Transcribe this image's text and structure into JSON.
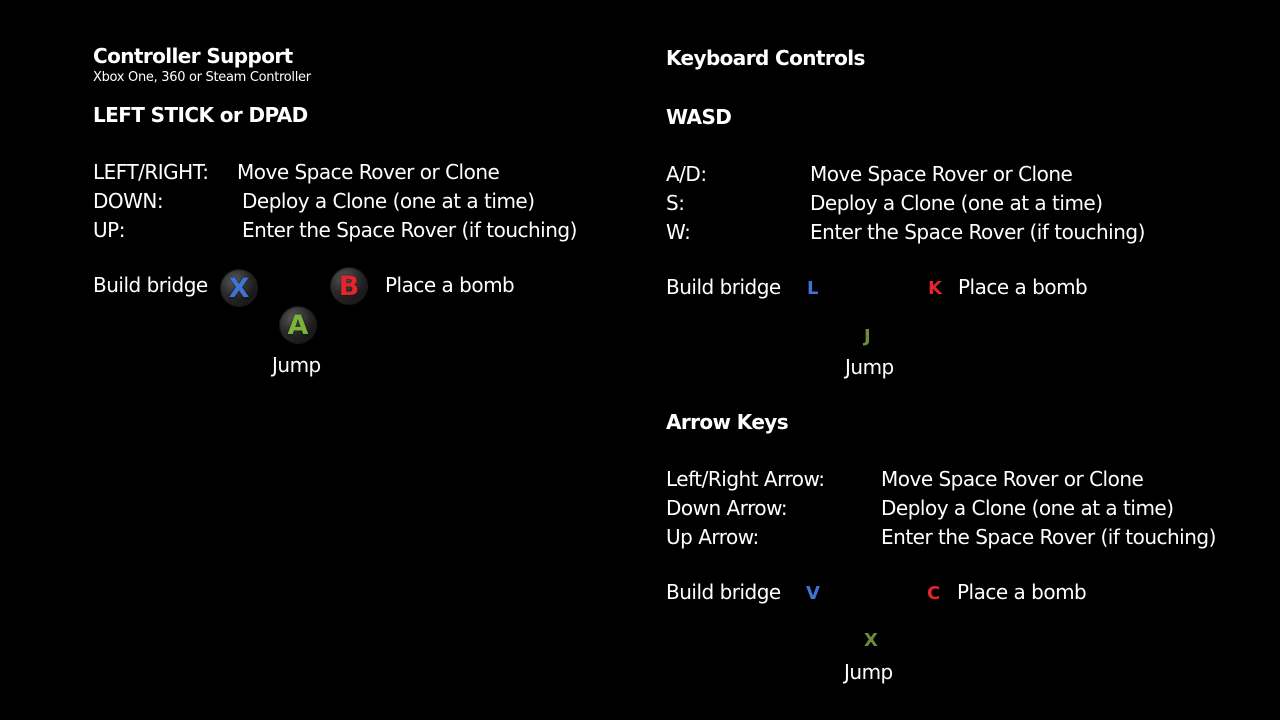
{
  "colors": {
    "background": "#000000",
    "text": "#ffffff",
    "blue": "#3f74d6",
    "red": "#e2262c",
    "green": "#7ab33a",
    "olive": "#6f8a3b"
  },
  "controller": {
    "title": "Controller Support",
    "subtitle": "Xbox One, 360 or Steam Controller",
    "stick_heading": "LEFT STICK or DPAD",
    "bindings": [
      {
        "key": "LEFT/RIGHT:",
        "action": "Move Space Rover or Clone"
      },
      {
        "key": "DOWN:",
        "action": "Deploy a Clone (one at a time)"
      },
      {
        "key": "UP:",
        "action": "Enter the Space Rover (if touching)"
      }
    ],
    "build_label": "Build bridge",
    "bomb_label": "Place a bomb",
    "jump_label": "Jump",
    "buttons": {
      "build": {
        "letter": "X",
        "icon": "xbox-x-button-icon"
      },
      "bomb": {
        "letter": "B",
        "icon": "xbox-b-button-icon"
      },
      "jump": {
        "letter": "A",
        "icon": "xbox-a-button-icon"
      }
    }
  },
  "keyboard": {
    "title": "Keyboard Controls",
    "wasd": {
      "heading": "WASD",
      "bindings": [
        {
          "key": "A/D:",
          "action": "Move Space Rover or Clone"
        },
        {
          "key": "S:",
          "action": "Deploy a Clone (one at a time)"
        },
        {
          "key": "W:",
          "action": "Enter the Space Rover (if touching)"
        }
      ],
      "build_label": "Build bridge",
      "build_key": "L",
      "bomb_key": "K",
      "bomb_label": "Place a bomb",
      "jump_key": "J",
      "jump_label": "Jump"
    },
    "arrows": {
      "heading": "Arrow Keys",
      "bindings": [
        {
          "key": "Left/Right Arrow:",
          "action": "Move Space Rover or Clone"
        },
        {
          "key": "Down Arrow:",
          "action": "Deploy a Clone (one at a time)"
        },
        {
          "key": "Up Arrow:",
          "action": "Enter the Space Rover (if touching)"
        }
      ],
      "build_label": "Build bridge",
      "build_key": "V",
      "bomb_key": "C",
      "bomb_label": "Place a bomb",
      "jump_key": "X",
      "jump_label": "Jump"
    }
  }
}
